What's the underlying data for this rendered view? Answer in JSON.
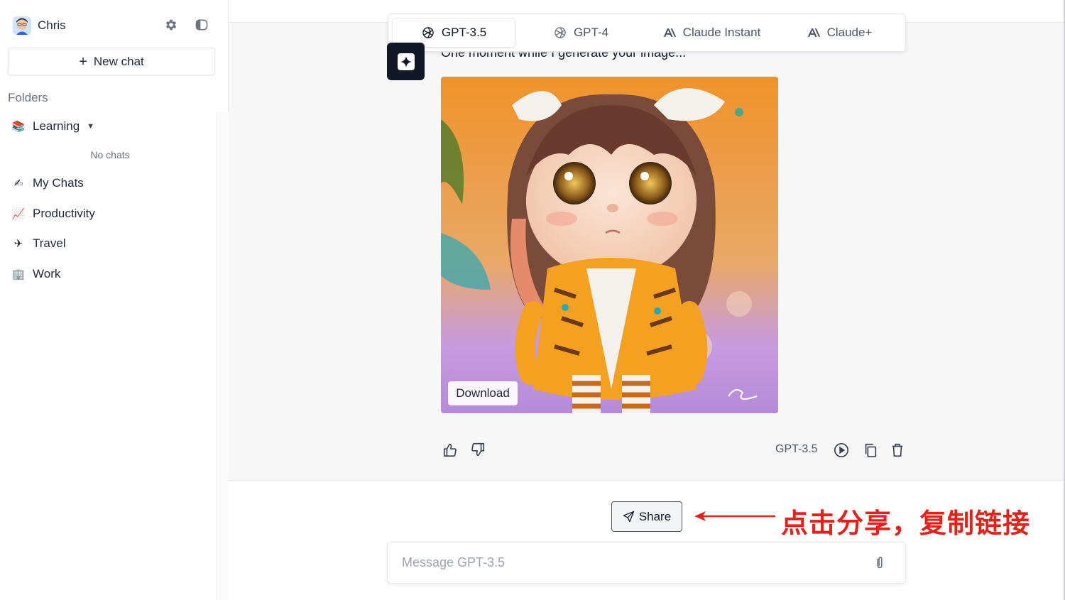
{
  "sidebar": {
    "user_name": "Chris",
    "new_chat_label": "New chat",
    "folders_label": "Folders",
    "learning_folder": {
      "icon": "books-icon",
      "label": "Learning",
      "empty_text": "No chats"
    },
    "folders": [
      {
        "icon": "writing-hand-icon",
        "emoji": "✍",
        "label": "My Chats"
      },
      {
        "icon": "chart-increasing-icon",
        "emoji": "📈",
        "label": "Productivity"
      },
      {
        "icon": "airplane-icon",
        "emoji": "✈",
        "label": "Travel"
      },
      {
        "icon": "office-building-icon",
        "emoji": "🏢",
        "label": "Work"
      }
    ]
  },
  "models": {
    "tabs": [
      {
        "label": "GPT-3.5",
        "icon": "openai-icon",
        "active": true
      },
      {
        "label": "GPT-4",
        "icon": "openai-icon",
        "active": false
      },
      {
        "label": "Claude Instant",
        "icon": "anthropic-icon",
        "active": false
      },
      {
        "label": "Claude+",
        "icon": "anthropic-icon",
        "active": false
      }
    ]
  },
  "message": {
    "text": "One moment while I generate your image...",
    "download_label": "Download",
    "model_label": "GPT-3.5"
  },
  "share": {
    "button_label": "Share",
    "annotation": "点击分享，复制链接",
    "annotation_color": "#e0241c"
  },
  "composer": {
    "placeholder": "Message GPT-3.5"
  }
}
